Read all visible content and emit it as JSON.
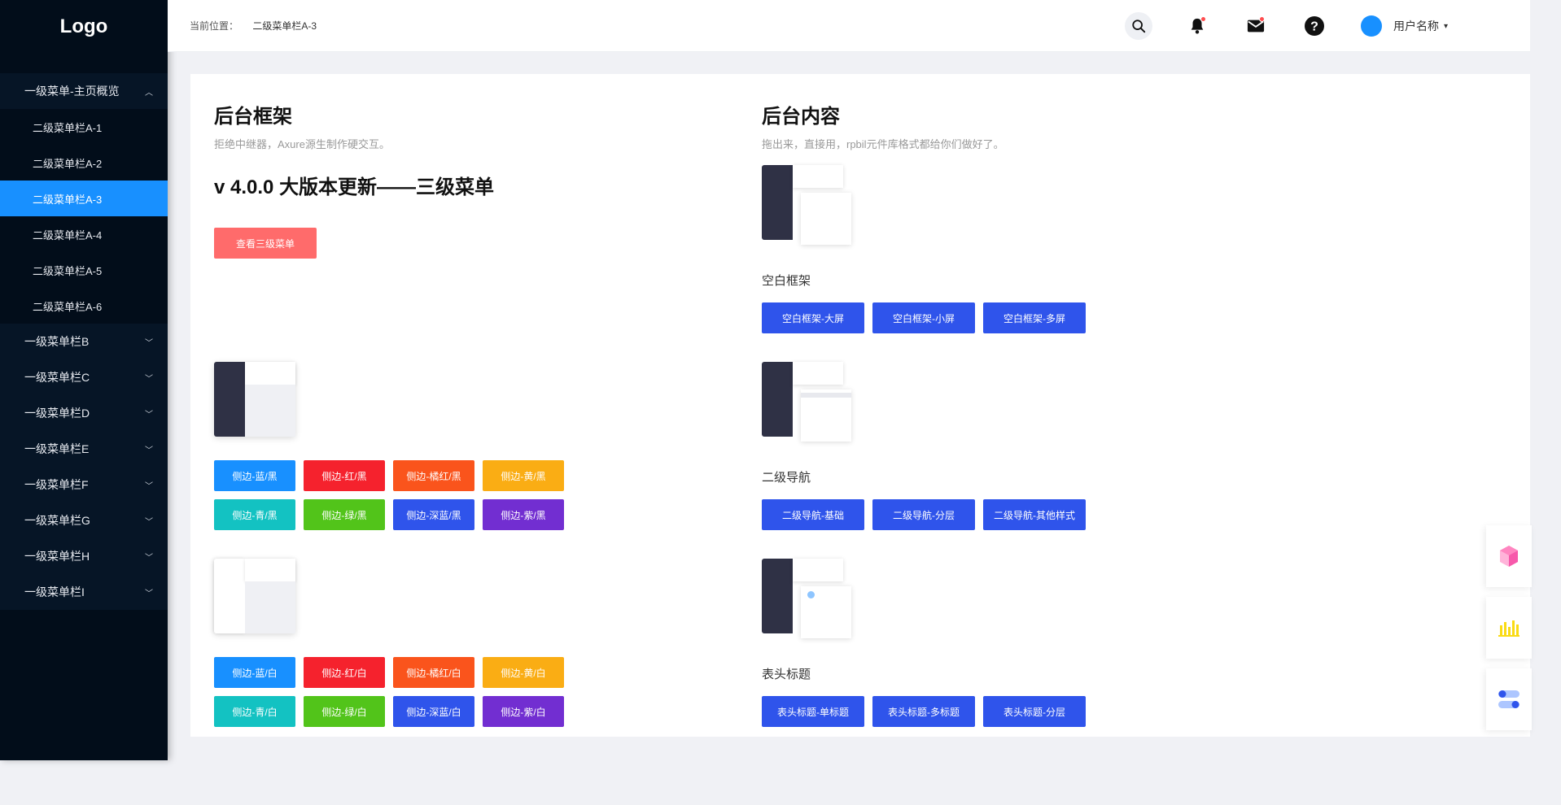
{
  "sidebar": {
    "logo": "Logo",
    "open_group": {
      "label": "一级菜单-主页概览"
    },
    "sub_items": [
      {
        "label": "二级菜单栏A-1"
      },
      {
        "label": "二级菜单栏A-2"
      },
      {
        "label": "二级菜单栏A-3"
      },
      {
        "label": "二级菜单栏A-4"
      },
      {
        "label": "二级菜单栏A-5"
      },
      {
        "label": "二级菜单栏A-6"
      }
    ],
    "groups": [
      {
        "label": "一级菜单栏B"
      },
      {
        "label": "一级菜单栏C"
      },
      {
        "label": "一级菜单栏D"
      },
      {
        "label": "一级菜单栏E"
      },
      {
        "label": "一级菜单栏F"
      },
      {
        "label": "一级菜单栏G"
      },
      {
        "label": "一级菜单栏H"
      },
      {
        "label": "一级菜单栏I"
      }
    ]
  },
  "topbar": {
    "crumb_label": "当前位置：",
    "crumb_value": "二级菜单栏A-3",
    "user_name": "用户名称"
  },
  "left": {
    "title": "后台框架",
    "subtitle": "拒绝中继器，Axure源生制作硬交互。",
    "version": "v 4.0.0 大版本更新——三级菜单",
    "cta": "查看三级菜单",
    "dark_buttons": [
      "侧边-蓝/黑",
      "侧边-红/黑",
      "侧边-橘红/黑",
      "侧边-黄/黑",
      "侧边-青/黑",
      "侧边-绿/黑",
      "侧边-深蓝/黑",
      "侧边-紫/黑"
    ],
    "light_buttons": [
      "侧边-蓝/白",
      "侧边-红/白",
      "侧边-橘红/白",
      "侧边-黄/白",
      "侧边-青/白",
      "侧边-绿/白",
      "侧边-深蓝/白",
      "侧边-紫/白"
    ]
  },
  "right": {
    "title": "后台内容",
    "subtitle": "拖出来，直接用，rpbil元件库格式都给你们做好了。",
    "sections": [
      {
        "label": "空白框架",
        "buttons": [
          "空白框架-大屏",
          "空白框架-小屏",
          "空白框架-多屏"
        ]
      },
      {
        "label": "二级导航",
        "buttons": [
          "二级导航-基础",
          "二级导航-分层",
          "二级导航-其他样式"
        ]
      },
      {
        "label": "表头标题",
        "buttons": [
          "表头标题-单标题",
          "表头标题-多标题",
          "表头标题-分层"
        ]
      }
    ]
  },
  "colors": {
    "sidebar_bg": "#020d1a",
    "active": "#1890ff",
    "btn_colors": [
      "#1890ff",
      "#f5222d",
      "#fa541c",
      "#faad14",
      "#13c2c2",
      "#52c41a",
      "#2f54eb",
      "#722ed1"
    ],
    "primary_blue": "#2f54eb"
  }
}
